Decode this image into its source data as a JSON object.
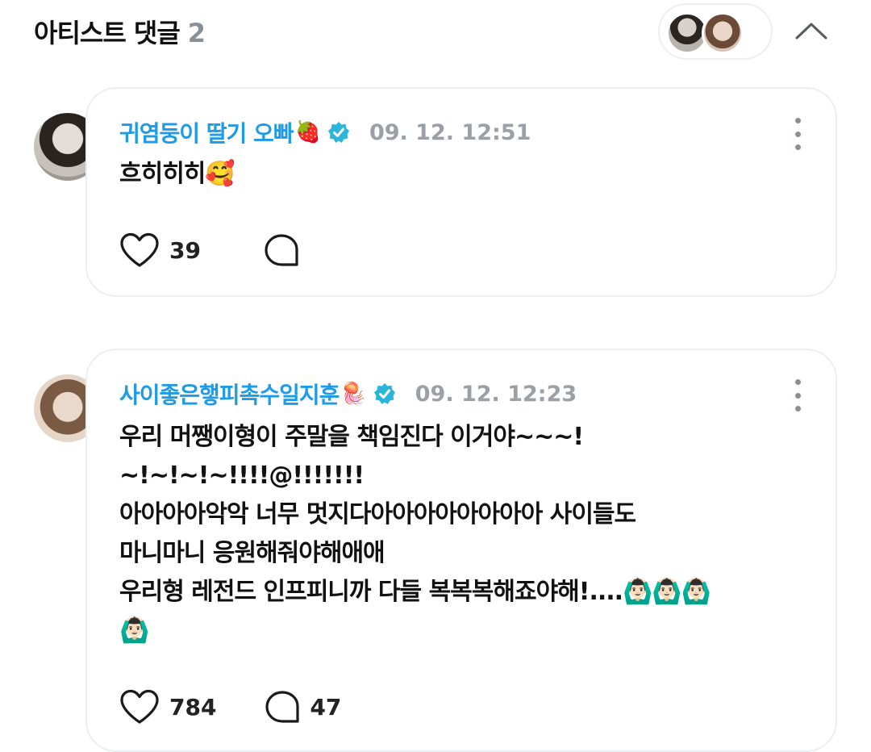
{
  "header": {
    "title": "아티스트 댓글",
    "count": "2"
  },
  "comments": [
    {
      "author": "귀염둥이 딸기 오빠",
      "author_emoji": "🍓",
      "time": "09. 12. 12:51",
      "lines": [
        "흐히히히🥰"
      ],
      "likes": "39",
      "replies": ""
    },
    {
      "author": "사이좋은햏피촉수일지훈",
      "author_emoji": "🪼",
      "time": "09. 12. 12:23",
      "lines": [
        "우리 머쨍이형이 주말을 책임진다 이거야~~~!",
        "~!~!~!~!!!!@!!!!!!!",
        "아아아아악악 너무 멋지다아아아아아아아아 사이들도",
        "마니마니 응원해줘야해애애",
        "우리형 레전드 인프피니까 다들 복복복해죠야해!....🙆🏻‍♂️🙆🏻‍♂️🙆🏻‍♂️",
        "🙆🏻‍♂️"
      ],
      "likes": "784",
      "replies": "47"
    }
  ],
  "colors": {
    "author": "#1e9be6",
    "verified": "#2bb5d8",
    "muted": "#9aa0a6",
    "border": "#eceef1"
  },
  "icons": [
    "chevron-up-icon",
    "verified-badge-icon",
    "more-vertical-icon",
    "heart-icon",
    "comment-bubble-icon"
  ]
}
